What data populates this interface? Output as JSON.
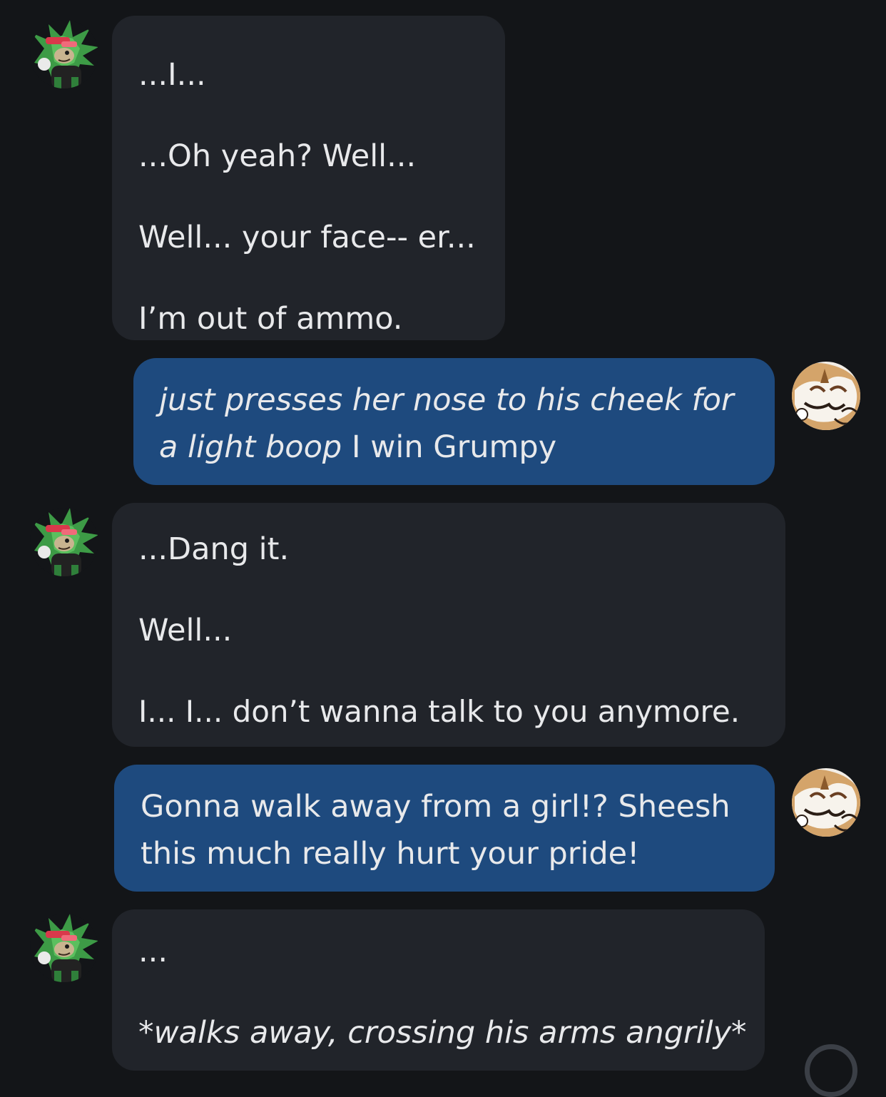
{
  "conversation": {
    "messages": [
      {
        "sender": "character",
        "avatar_icon": "green-hedgehog-avatar-icon",
        "lines": [
          "...I...",
          "...Oh yeah? Well...",
          "Well... your face-- er...",
          "I’m out of ammo."
        ]
      },
      {
        "sender": "user",
        "avatar_icon": "cream-fox-avatar-icon",
        "action": "just presses her nose to his cheek for a light boop",
        "text": "I win Grumpy"
      },
      {
        "sender": "character",
        "avatar_icon": "green-hedgehog-avatar-icon",
        "lines": [
          "...Dang it.",
          "Well...",
          "I... I... don’t wanna talk to you anymore."
        ]
      },
      {
        "sender": "user",
        "avatar_icon": "cream-fox-avatar-icon",
        "lines": [
          "Gonna walk away from a girl!? Sheesh",
          "this much really hurt your pride!"
        ]
      },
      {
        "sender": "character",
        "avatar_icon": "green-hedgehog-avatar-icon",
        "lines": [
          "...",
          "*walks away, crossing his arms angrily*"
        ]
      }
    ]
  },
  "colors": {
    "background": "#131518",
    "character_bubble": "#21242a",
    "user_bubble": "#1e4a7e",
    "text": "#e8e9eb"
  }
}
